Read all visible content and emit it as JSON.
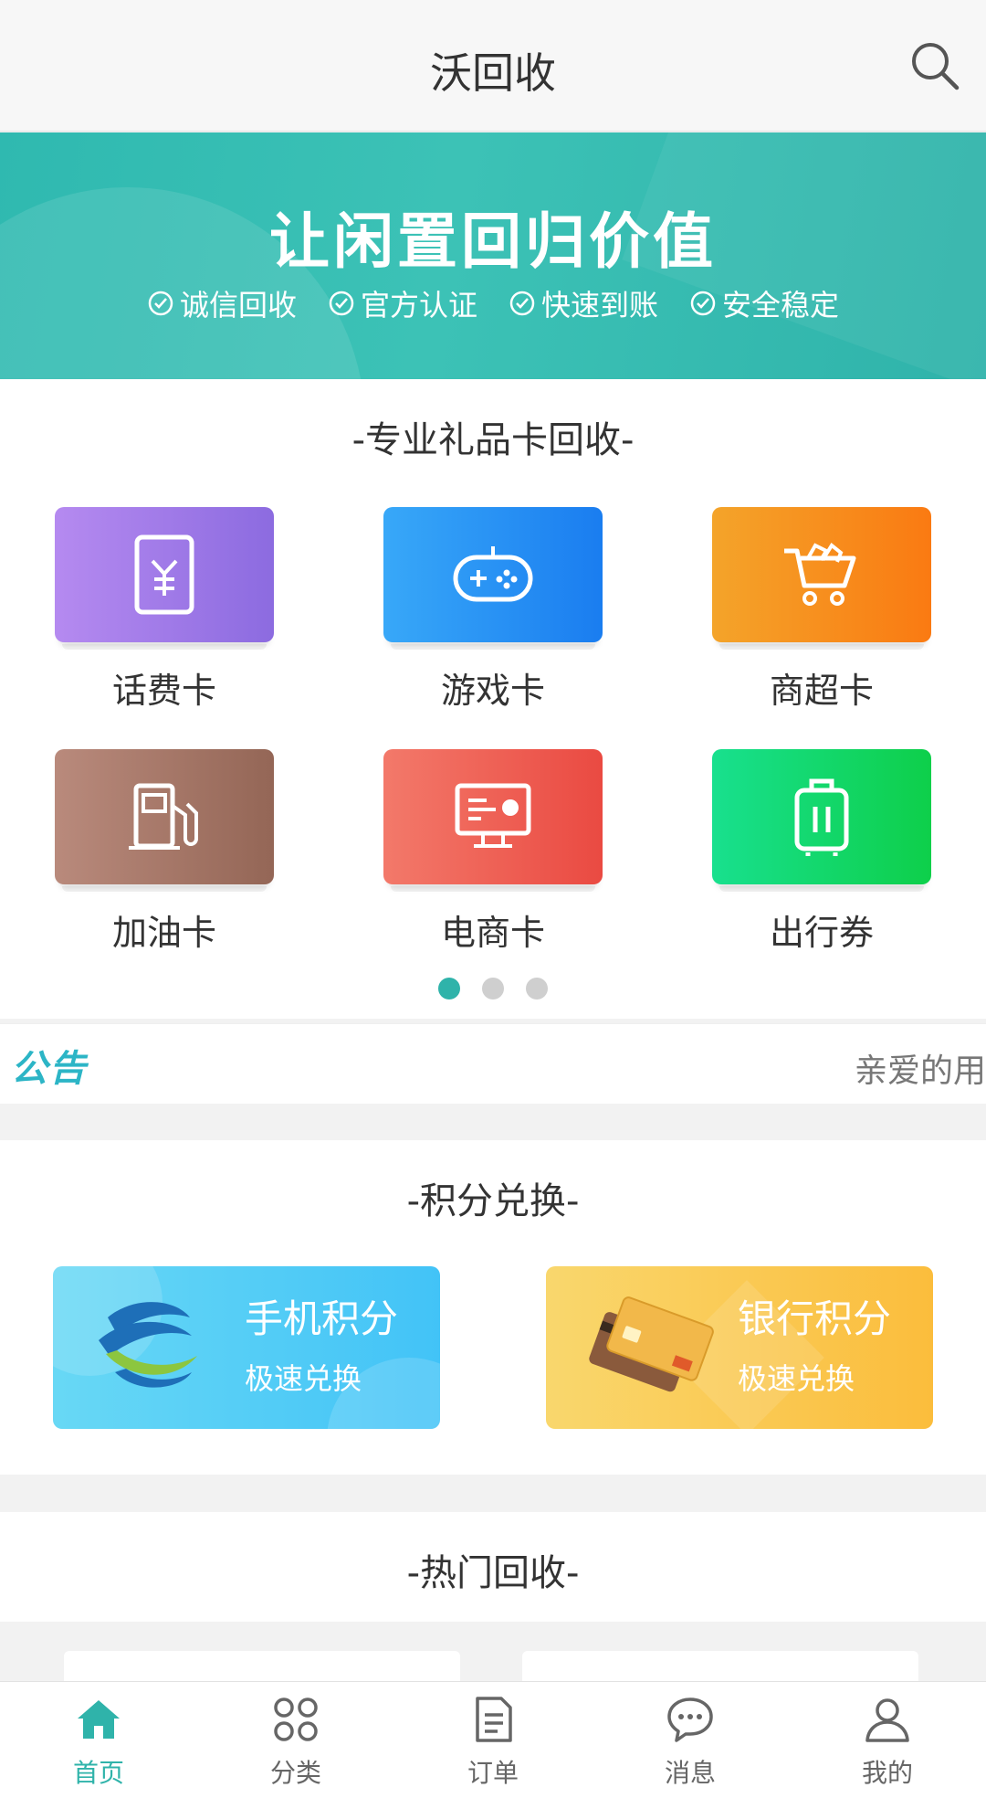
{
  "header": {
    "title": "沃回收",
    "search_icon": "search-icon"
  },
  "banner": {
    "headline": "让闲置回归价值",
    "tags": [
      "诚信回收",
      "官方认证",
      "快速到账",
      "安全稳定"
    ]
  },
  "gift_section": {
    "title": "-专业礼品卡回收-",
    "items": [
      {
        "label": "话费卡",
        "icon": "phone-yuan-icon",
        "color": "#a07be8"
      },
      {
        "label": "游戏卡",
        "icon": "gamepad-icon",
        "color": "#2a8ff5"
      },
      {
        "label": "商超卡",
        "icon": "shopping-cart-icon",
        "color": "#f78c1e"
      },
      {
        "label": "加油卡",
        "icon": "fuel-pump-icon",
        "color": "#a87668"
      },
      {
        "label": "电商卡",
        "icon": "monitor-icon",
        "color": "#ee5a4f"
      },
      {
        "label": "出行券",
        "icon": "luggage-icon",
        "color": "#14d86e"
      }
    ],
    "pagination": {
      "count": 3,
      "active": 0
    }
  },
  "notice": {
    "tag": "公告",
    "text": "亲爱的用"
  },
  "points_section": {
    "title": "-积分兑换-",
    "cards": [
      {
        "title": "手机积分",
        "subtitle": "极速兑换",
        "icon": "china-mobile-logo"
      },
      {
        "title": "银行积分",
        "subtitle": "极速兑换",
        "icon": "credit-card-icon"
      }
    ]
  },
  "hot_section": {
    "title": "-热门回收-"
  },
  "bottom_nav": {
    "items": [
      {
        "label": "首页",
        "icon": "home-icon",
        "active": true
      },
      {
        "label": "分类",
        "icon": "category-icon",
        "active": false
      },
      {
        "label": "订单",
        "icon": "order-icon",
        "active": false
      },
      {
        "label": "消息",
        "icon": "message-icon",
        "active": false
      },
      {
        "label": "我的",
        "icon": "user-icon",
        "active": false
      }
    ]
  },
  "colors": {
    "accent": "#2fb3aa",
    "notice_tag": "#2cb5c6"
  }
}
